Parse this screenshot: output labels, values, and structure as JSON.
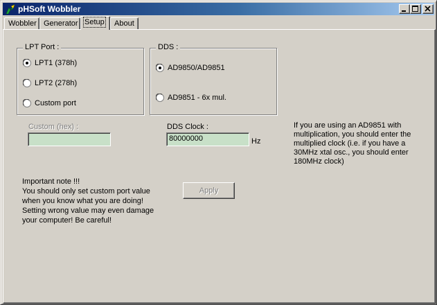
{
  "window": {
    "title": "pHSoft Wobbler",
    "icon": "wobbler-app-icon"
  },
  "tabs": [
    {
      "label": "Wobbler",
      "active": false
    },
    {
      "label": "Generator",
      "active": false
    },
    {
      "label": "Setup",
      "active": true
    },
    {
      "label": "About",
      "active": false
    }
  ],
  "lpt_group": {
    "label": "LPT Port :",
    "options": [
      {
        "label": "LPT1 (378h)",
        "checked": true
      },
      {
        "label": "LPT2 (278h)",
        "checked": false
      },
      {
        "label": "Custom port",
        "checked": false
      }
    ]
  },
  "dds_group": {
    "label": "DDS :",
    "options": [
      {
        "label": "AD9850/AD9851",
        "checked": true
      },
      {
        "label": "AD9851 - 6x mul.",
        "checked": false
      }
    ]
  },
  "custom": {
    "label": "Custom (hex) :",
    "value": "",
    "disabled": true
  },
  "dds_clock": {
    "label": "DDS Clock :",
    "value": "80000000",
    "unit": "Hz"
  },
  "info_text": "If you are using an AD9851 with\nmultiplication, you should enter the\nmultiplied clock (i.e. if you have a\n30MHz xtal osc., you should enter\n180MHz clock)",
  "important_note": "Important note !!!\nYou should only set custom port value\nwhen you know what you are doing!\nSetting wrong value may even damage\nyour computer! Be careful!",
  "apply_button": {
    "label": "Apply",
    "disabled": true
  },
  "colors": {
    "title_start": "#0a246a",
    "title_end": "#a6caf0",
    "face": "#d4d0c8",
    "input_bg": "#c8e0c8"
  }
}
